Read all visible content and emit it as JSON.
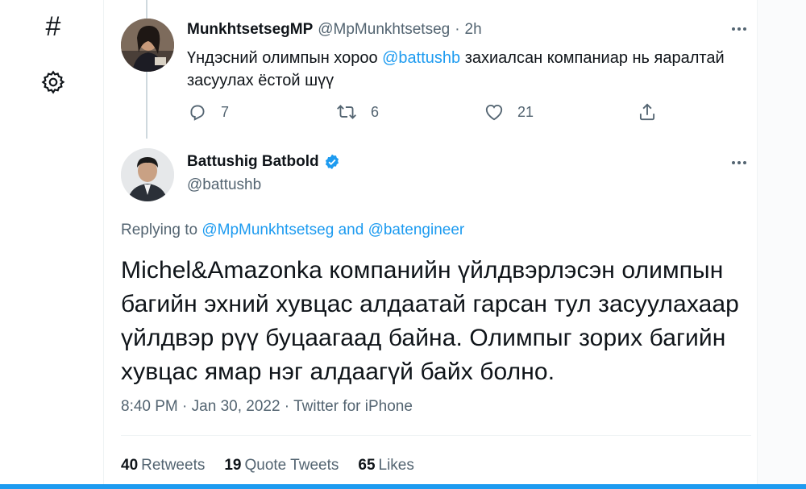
{
  "rail": {
    "icons": [
      "hashtag-icon",
      "settings-gear-icon"
    ],
    "hash_glyph": "#"
  },
  "tweet1": {
    "name": "MunkhtsetsegMP",
    "handle": "@MpMunkhtsetseg",
    "dot": "·",
    "time": "2h",
    "body_pre": "Үндэсний олимпын хороо ",
    "body_mention": "@battushb",
    "body_post": " захиалсан компаниар нь яаралтай засуулах ёстой шүү",
    "replies": "7",
    "retweets": "6",
    "likes": "21"
  },
  "tweet2": {
    "name": "Battushig Batbold",
    "handle": "@battushb",
    "replying_prefix": "Replying to ",
    "replying_mention1": "@MpMunkhtsetseg",
    "replying_and": " and ",
    "replying_mention2": "@batengineer",
    "body": "Michel&Amazonka компанийн үйлдвэрлэсэн олимпын багийн эхний хувцас алдаатай гарсан тул засуулахаар үйлдвэр рүү буцаагаад байна. Олимпыг зорих багийн хувцас ямар нэг алдаагүй байх болно.",
    "time": "8:40 PM",
    "sep": " · ",
    "date": "Jan 30, 2022",
    "source": "Twitter for iPhone"
  },
  "stats": {
    "retweets_count": "40",
    "retweets_label": "Retweets",
    "quotes_count": "19",
    "quotes_label": "Quote Tweets",
    "likes_count": "65",
    "likes_label": "Likes"
  },
  "colors": {
    "accent": "#1d9bf0",
    "text": "#0f1419",
    "secondary": "#536471",
    "border": "#eff3f4"
  }
}
